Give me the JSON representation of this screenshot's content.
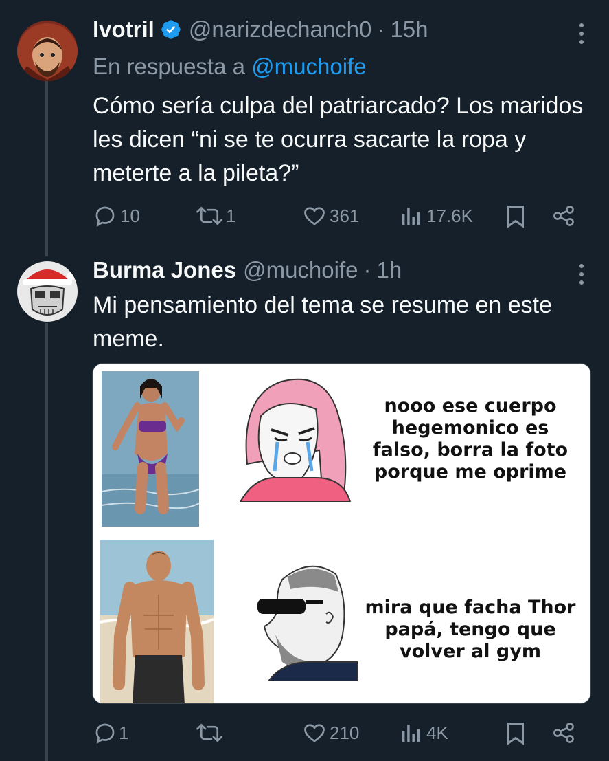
{
  "tweets": [
    {
      "name": "Ivotril",
      "handle": "@narizdechanch0",
      "separator": "·",
      "time": "15h",
      "reply_prefix": "En respuesta a",
      "reply_mention": "@muchoife",
      "text": "Cómo sería culpa del patriarcado? Los maridos les dicen “ni se te ocurra sacarte la ropa y meterte a la pileta?”",
      "replies": "10",
      "retweets": "1",
      "likes": "361",
      "views": "17.6K"
    },
    {
      "name": "Burma Jones",
      "handle": "@muchoife",
      "separator": "·",
      "time": "1h",
      "text": "Mi pensamiento del tema se resume en este meme.",
      "meme": {
        "top_text": "nooo ese cuerpo hegemonico es falso, borra la foto porque me oprime",
        "bottom_text": "mira que facha Thor papá, tengo que volver al gym"
      },
      "replies": "1",
      "retweets": "",
      "likes": "210",
      "views": "4K"
    }
  ],
  "colors": {
    "background": "#15202b",
    "text_primary": "#f7f9f9",
    "text_secondary": "#8b98a5",
    "accent": "#1d9bf0",
    "thread_line": "#38444d"
  },
  "icons": [
    "verified-icon",
    "more-icon",
    "reply-icon",
    "retweet-icon",
    "like-icon",
    "views-icon",
    "bookmark-icon",
    "share-icon"
  ]
}
